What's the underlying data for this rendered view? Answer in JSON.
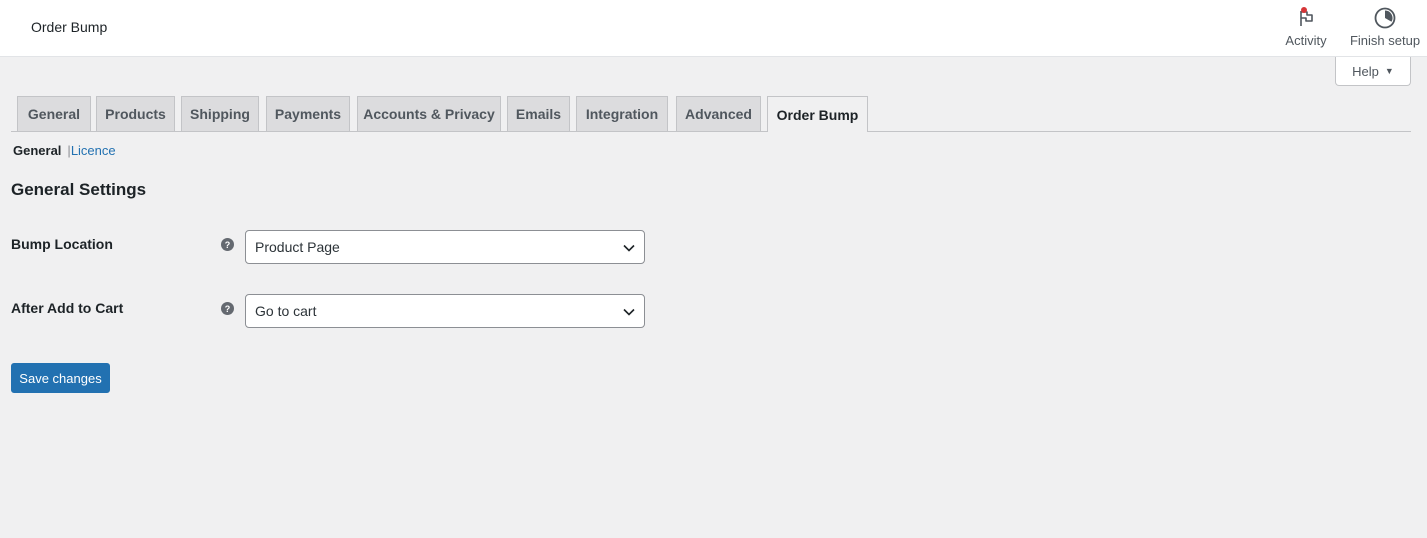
{
  "header": {
    "title": "Order Bump",
    "activity_label": "Activity",
    "finish_setup_label": "Finish setup",
    "help_label": "Help"
  },
  "tabs": [
    {
      "label": "General"
    },
    {
      "label": "Products"
    },
    {
      "label": "Shipping"
    },
    {
      "label": "Payments"
    },
    {
      "label": "Accounts & Privacy"
    },
    {
      "label": "Emails"
    },
    {
      "label": "Integration"
    },
    {
      "label": "Advanced"
    },
    {
      "label": "Order Bump",
      "active": true
    }
  ],
  "subnav": {
    "current": "General",
    "separator": "|",
    "link": "Licence"
  },
  "section": {
    "title": "General Settings",
    "fields": [
      {
        "label": "Bump Location",
        "value": "Product Page"
      },
      {
        "label": "After Add to Cart",
        "value": "Go to cart"
      }
    ],
    "save_label": "Save changes"
  },
  "colors": {
    "accent": "#2271b1",
    "notification_dot": "#d63638",
    "background": "#f0f0f1"
  }
}
